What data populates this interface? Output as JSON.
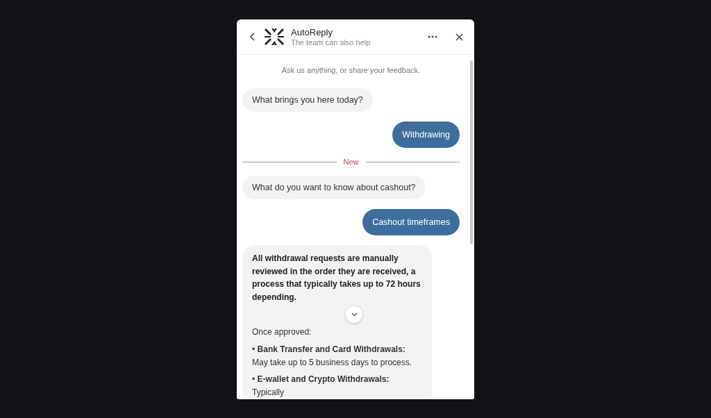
{
  "header": {
    "title": "AutoReply",
    "subtitle": "The team can also help"
  },
  "intro": "Ask us anything, or share your feedback.",
  "messages": [
    {
      "kind": "bot",
      "text": "What brings you here today?"
    },
    {
      "kind": "user",
      "text": "Withdrawing"
    },
    {
      "kind": "divider",
      "text": "New"
    },
    {
      "kind": "bot",
      "text": "What do you want to know about cashout?"
    },
    {
      "kind": "user",
      "text": "Cashout timeframes"
    },
    {
      "kind": "rich",
      "lead": "All withdrawal requests are manually reviewed in the order they are received, a process that typically takes up to 72 hours depending.",
      "subhead": "Once approved:",
      "bullets": [
        "• **Bank Transfer and Card Withdrawals:** May take up to 5 business days to process.",
        "• **E-wallet and Crypto Withdrawals:** Typically"
      ]
    }
  ]
}
